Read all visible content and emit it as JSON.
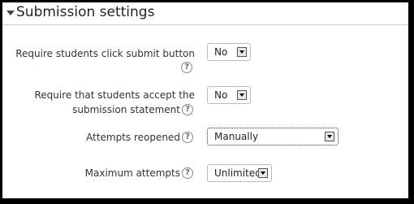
{
  "section": {
    "title": "Submission settings"
  },
  "fields": {
    "require_click_submit": {
      "label": "Require students click submit button",
      "value": "No"
    },
    "require_accept_statement": {
      "label_line1": "Require that students accept the",
      "label_line2": "submission statement",
      "value": "No"
    },
    "attempts_reopened": {
      "label": "Attempts reopened",
      "value": "Manually"
    },
    "maximum_attempts": {
      "label": "Maximum attempts",
      "value": "Unlimited"
    }
  },
  "help_glyph": "?"
}
